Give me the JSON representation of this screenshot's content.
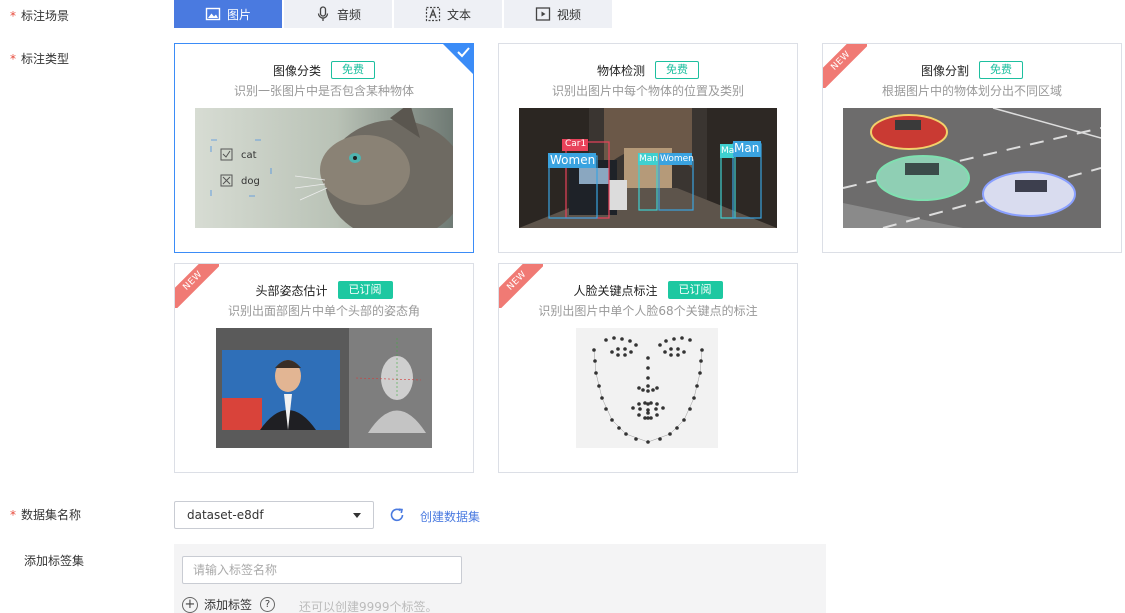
{
  "scene": {
    "label": "标注场景",
    "tabs": [
      {
        "label": "图片",
        "icon": "image-icon",
        "active": true
      },
      {
        "label": "音频",
        "icon": "microphone-icon",
        "active": false
      },
      {
        "label": "文本",
        "icon": "text-icon",
        "active": false
      },
      {
        "label": "视频",
        "icon": "video-play-icon",
        "active": false
      }
    ]
  },
  "type": {
    "label": "标注类型",
    "cards": [
      {
        "name": "图像分类",
        "badge": "免费",
        "badge_kind": "free",
        "desc": "识别一张图片中是否包含某种物体",
        "selected": true,
        "is_new": false,
        "thumb_labels": [
          "cat",
          "dog"
        ]
      },
      {
        "name": "物体检测",
        "badge": "免费",
        "badge_kind": "free",
        "desc": "识别出图片中每个物体的位置及类别",
        "selected": false,
        "is_new": false,
        "thumb_labels": [
          "Car1",
          "Women",
          "Man",
          "Women",
          "Ma",
          "Man"
        ]
      },
      {
        "name": "图像分割",
        "badge": "免费",
        "badge_kind": "free",
        "desc": "根据图片中的物体划分出不同区域",
        "selected": false,
        "is_new": true
      },
      {
        "name": "头部姿态估计",
        "badge": "已订阅",
        "badge_kind": "subscribed",
        "desc": "识别出面部图片中单个头部的姿态角",
        "selected": false,
        "is_new": true
      },
      {
        "name": "人脸关键点标注",
        "badge": "已订阅",
        "badge_kind": "subscribed",
        "desc": "识别出图片中单个人脸68个关键点的标注",
        "selected": false,
        "is_new": true
      }
    ],
    "new_text": "NEW"
  },
  "dataset": {
    "label": "数据集名称",
    "value": "dataset-e8df",
    "create_link": "创建数据集"
  },
  "tagset": {
    "label": "添加标签集",
    "placeholder": "请输入标签名称",
    "add_label": "添加标签",
    "hint": "还可以创建9999个标签。"
  },
  "colors": {
    "accent": "#4a7ae0",
    "free": "#1dbf9f",
    "subscribed": "#1dc8a1",
    "required": "#e84c3d",
    "new_ribbon": "#f07a74"
  }
}
